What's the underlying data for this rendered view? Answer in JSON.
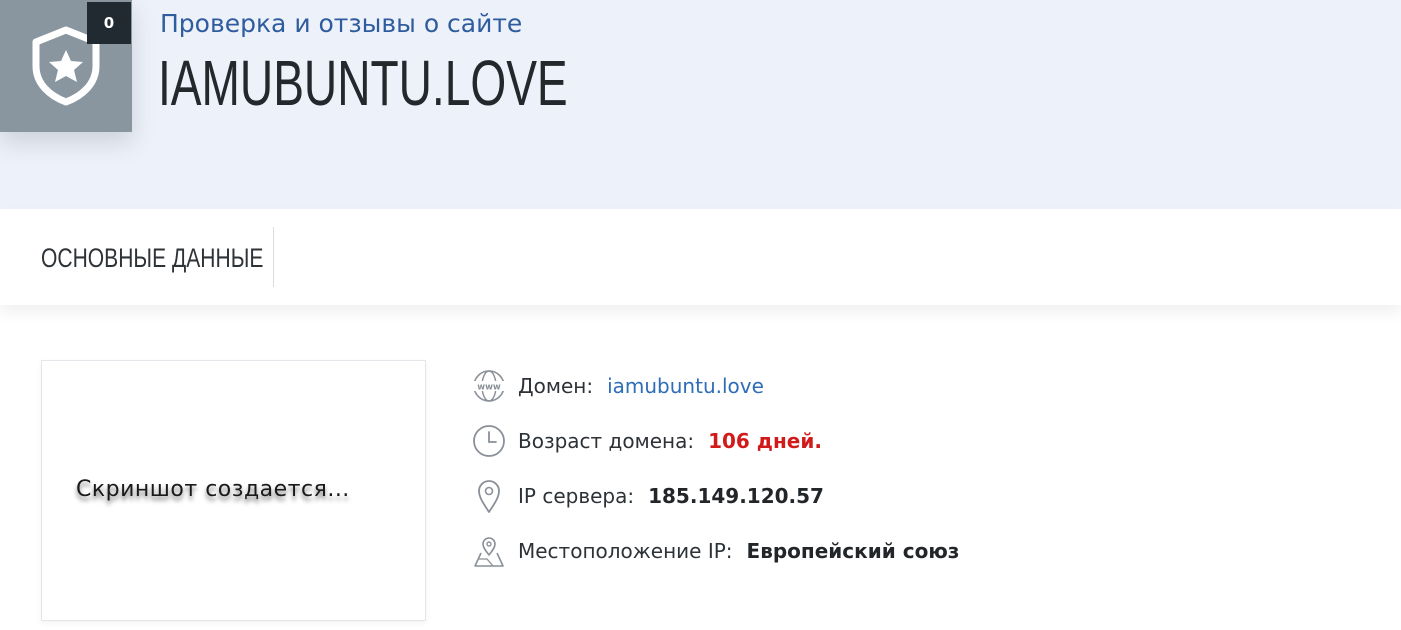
{
  "header": {
    "counter": "0",
    "subtitle": "Проверка и отзывы о сайте",
    "site_title": "IAMUBUNTU.LOVE"
  },
  "tabs": [
    {
      "label": "ОСНОВНЫЕ ДАННЫЕ"
    }
  ],
  "screenshot": {
    "placeholder": "Скриншот создается..."
  },
  "info": {
    "domain_label": "Домен:",
    "domain_value": "iamubuntu.love",
    "age_label": "Возраст домена:",
    "age_value": "106 дней.",
    "ip_label": "IP сервера:",
    "ip_value": "185.149.120.57",
    "location_label": "Местоположение IP:",
    "location_value": "Европейский союз"
  },
  "colors": {
    "header_bg": "#edf1f9",
    "logo_bg": "#8a969f",
    "subtitle": "#2f5c9e",
    "link": "#2e6db8",
    "alert": "#d11a1a"
  },
  "icons": [
    "shield-star-icon",
    "globe-www-icon",
    "clock-icon",
    "map-pin-icon",
    "map-location-icon"
  ]
}
